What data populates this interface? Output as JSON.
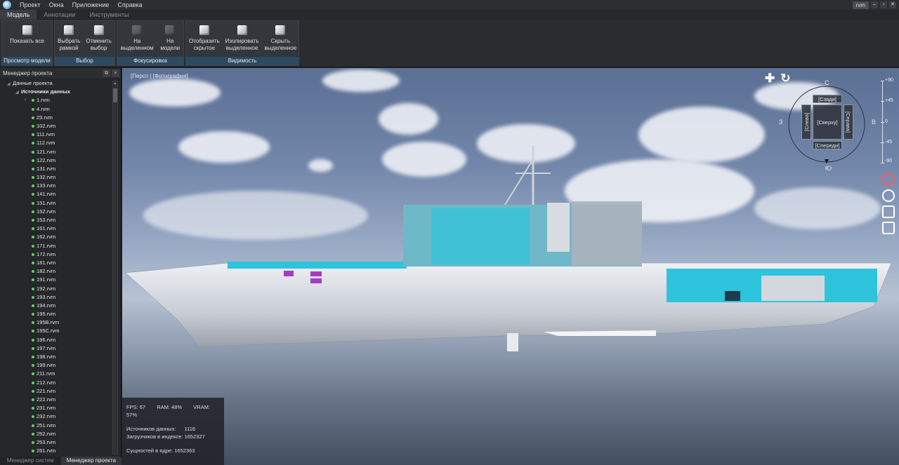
{
  "menubar": {
    "items": [
      "Проект",
      "Окна",
      "Приложение",
      "Справка"
    ],
    "doc_tab": "rvm",
    "win_buttons": [
      "–",
      "▫",
      "✕"
    ]
  },
  "ribbon_tabs": [
    "Модель",
    "Аннотации",
    "Инструменты"
  ],
  "ribbon": {
    "groups": [
      {
        "label": "Просмотр модели",
        "buttons": [
          {
            "l1": "Показать все",
            "l2": ""
          }
        ]
      },
      {
        "label": "Выбор",
        "buttons": [
          {
            "l1": "Выбрать",
            "l2": "рамкой"
          },
          {
            "l1": "Отменить",
            "l2": "выбор"
          }
        ]
      },
      {
        "label": "Фокусировка",
        "buttons": [
          {
            "l1": "На",
            "l2": "выделенном"
          },
          {
            "l1": "На",
            "l2": "модели"
          }
        ]
      },
      {
        "label": "Видимость",
        "buttons": [
          {
            "l1": "Отобразить",
            "l2": "скрытое"
          },
          {
            "l1": "Изолировать",
            "l2": "выделенное"
          },
          {
            "l1": "Скрыть",
            "l2": "выделенное"
          }
        ]
      }
    ]
  },
  "panel": {
    "title": "Менеджер проекта",
    "root": "Данные проекта",
    "sources": "Источники данных",
    "files": [
      "1.rvm",
      "4.rvm",
      "23.rvm",
      "102.rvm",
      "111.rvm",
      "112.rvm",
      "121.rvm",
      "122.rvm",
      "131.rvm",
      "132.rvm",
      "133.rvm",
      "141.rvm",
      "151.rvm",
      "152.rvm",
      "153.rvm",
      "161.rvm",
      "162.rvm",
      "171.rvm",
      "172.rvm",
      "181.rvm",
      "182.rvm",
      "191.rvm",
      "192.rvm",
      "193.rvm",
      "194.rvm",
      "195.rvm",
      "195B.rvm",
      "195C.rvm",
      "196.rvm",
      "197.rvm",
      "198.rvm",
      "199.rvm",
      "211.rvm",
      "212.rvm",
      "221.rvm",
      "222.rvm",
      "231.rvm",
      "232.rvm",
      "251.rvm",
      "252.rvm",
      "253.rvm",
      "261.rvm"
    ],
    "bottom_tabs": [
      "Менеджер систем",
      "Менеджер проекта"
    ]
  },
  "viewport": {
    "mode_label": "[Персп | [Фотография]",
    "compass": {
      "n": "С",
      "s": "Ю",
      "w": "З",
      "e": "В",
      "back": "[Сзади]",
      "top": "[Сверху]",
      "front": "[Спереди]",
      "left": "[Слева]",
      "right": "[Справа]"
    },
    "scale_labels": [
      "+90",
      "+45",
      "0",
      "-45",
      "-90"
    ],
    "hud": {
      "fps": "FPS: 67",
      "ram": "RAM: 48%",
      "vram": "VRAM: 57%",
      "sources_label": "Источников данных:",
      "sources_value": "1116",
      "loaders_label": "Загрузчиков в индексе:",
      "loaders_value": "1652327",
      "entities_label": "Сущностей в ядре:",
      "entities_value": "1652363"
    }
  },
  "colors": {
    "accent": "#2e4a62",
    "status_dot": "#5fd35f",
    "hull": "#d8dce4",
    "deck_accent": "#2ec4dc",
    "highlight": "#a83ac2"
  }
}
